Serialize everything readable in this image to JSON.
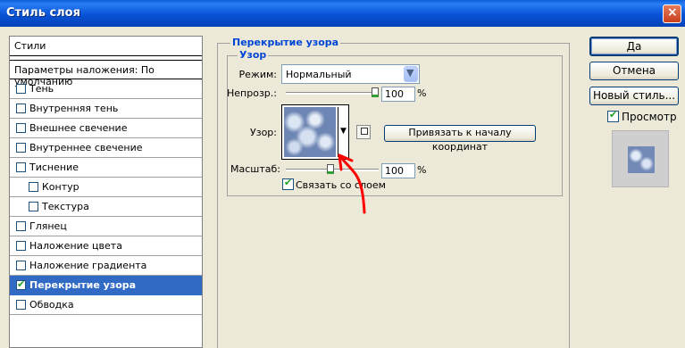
{
  "window": {
    "title": "Стиль слоя"
  },
  "styles_panel": {
    "header": "Стили",
    "defaults": "Параметры наложения: По умолчанию",
    "items": [
      {
        "label": "Тень",
        "checked": false,
        "selected": false
      },
      {
        "label": "Внутренняя тень",
        "checked": false,
        "selected": false
      },
      {
        "label": "Внешнее свечение",
        "checked": false,
        "selected": false
      },
      {
        "label": "Внутреннее свечение",
        "checked": false,
        "selected": false
      },
      {
        "label": "Тиснение",
        "checked": false,
        "selected": false
      },
      {
        "label": "Контур",
        "checked": false,
        "selected": false
      },
      {
        "label": "Текстура",
        "checked": false,
        "selected": false
      },
      {
        "label": "Глянец",
        "checked": false,
        "selected": false
      },
      {
        "label": "Наложение цвета",
        "checked": false,
        "selected": false
      },
      {
        "label": "Наложение градиента",
        "checked": false,
        "selected": false
      },
      {
        "label": "Перекрытие узора",
        "checked": true,
        "selected": true
      },
      {
        "label": "Обводка",
        "checked": false,
        "selected": false
      }
    ]
  },
  "pattern_overlay": {
    "group_title": "Перекрытие узора",
    "subgroup_title": "Узор",
    "mode_label": "Режим:",
    "mode_value": "Нормальный",
    "opacity_label": "Непрозр.:",
    "opacity_value": "100",
    "opacity_unit": "%",
    "opacity_level": 1.0,
    "pattern_label": "Узор:",
    "snap_button": "Привязать к началу координат",
    "scale_label": "Масштаб:",
    "scale_value": "100",
    "scale_unit": "%",
    "link_label": "Связать со слоем",
    "link_checked": true
  },
  "buttons": {
    "ok": "Да",
    "cancel": "Отмена",
    "new_style": "Новый стиль...",
    "preview_label": "Просмотр",
    "preview_checked": true
  },
  "colors": {
    "title_bar": "#0a5fd8",
    "selection": "#316ac5",
    "group_title": "#0046d5",
    "annotation_arrow": "#ff0000"
  }
}
